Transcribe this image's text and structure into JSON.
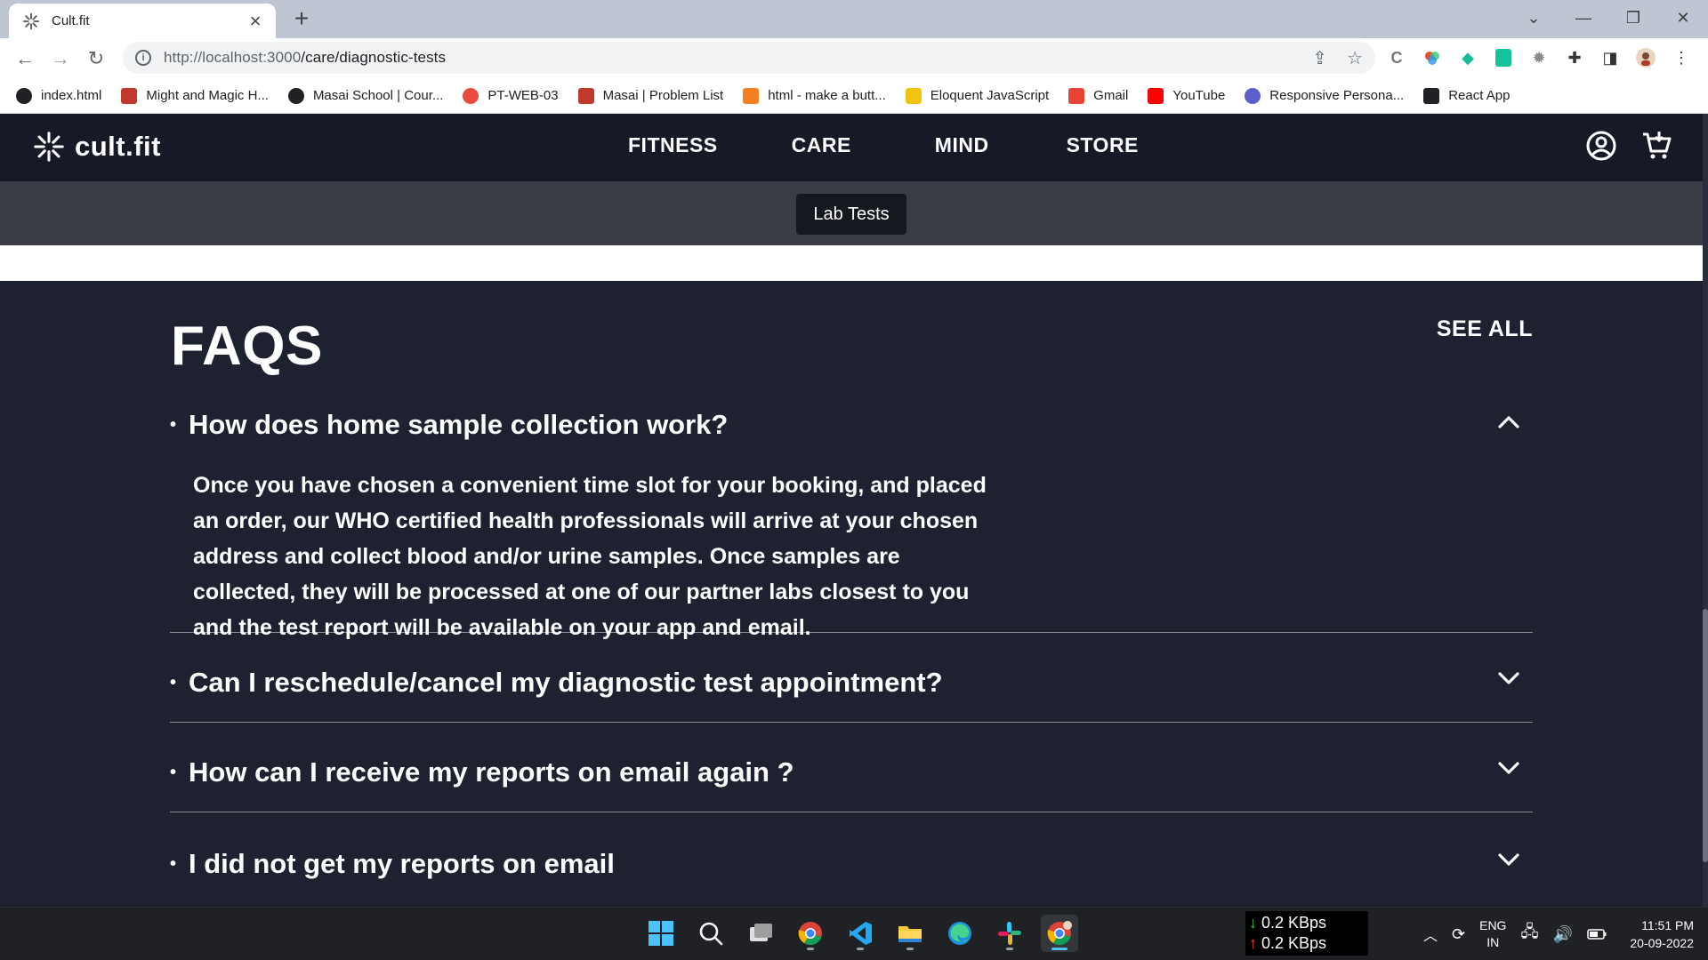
{
  "browser": {
    "tab_title": "Cult.fit",
    "url_host": "http://localhost:3000",
    "url_path": "/care/diagnostic-tests",
    "bookmarks": [
      {
        "label": "index.html",
        "icon": "globe-icon",
        "color": "#202124"
      },
      {
        "label": "Might and Magic H...",
        "icon": "game-icon",
        "color": "#c0392b"
      },
      {
        "label": "Masai School | Cour...",
        "icon": "globe-icon",
        "color": "#202124"
      },
      {
        "label": "PT-WEB-03",
        "icon": "gear-icon",
        "color": "#e74c3c"
      },
      {
        "label": "Masai | Problem List",
        "icon": "pin-icon",
        "color": "#c0392b"
      },
      {
        "label": "html - make a butt...",
        "icon": "stackoverflow-icon",
        "color": "#f48024"
      },
      {
        "label": "Eloquent JavaScript",
        "icon": "ejs-icon",
        "color": "#f1c40f"
      },
      {
        "label": "Gmail",
        "icon": "gmail-icon",
        "color": "#ea4335"
      },
      {
        "label": "YouTube",
        "icon": "youtube-icon",
        "color": "#ff0000"
      },
      {
        "label": "Responsive Persona...",
        "icon": "globe-icon",
        "color": "#5b5fc7"
      },
      {
        "label": "React App",
        "icon": "cultfit-icon",
        "color": "#202124"
      }
    ]
  },
  "site": {
    "logo_text": "cult.fit",
    "nav": [
      "FITNESS",
      "CARE",
      "MIND",
      "STORE"
    ],
    "subnav_button": "Lab Tests"
  },
  "faq": {
    "title": "FAQS",
    "see_all": "SEE ALL",
    "items": [
      {
        "question": "How does home sample collection work?",
        "expanded": true,
        "answer_lines": [
          "Once you have chosen a convenient time slot for your booking, and placed",
          "an order, our WHO certified health professionals will arrive at your chosen",
          "address and collect blood and/or urine samples. Once samples are",
          "collected, they will be processed at one of our partner labs closest to you",
          "and the test report will be available on your app and email."
        ]
      },
      {
        "question": "Can I reschedule/cancel my diagnostic test appointment?",
        "expanded": false
      },
      {
        "question": "How can I receive my reports on email again ?",
        "expanded": false
      },
      {
        "question": "I did not get my reports on email",
        "expanded": false
      }
    ]
  },
  "taskbar": {
    "net_down": "0.2 KBps",
    "net_up": "0.2 KBps",
    "lang_top": "ENG",
    "lang_bottom": "IN",
    "time": "11:51 PM",
    "date": "20-09-2022",
    "apps": [
      "windows-start-icon",
      "search-icon",
      "task-view-icon",
      "chrome-icon",
      "vscode-icon",
      "file-explorer-icon",
      "edge-icon",
      "slack-icon",
      "chrome-profile-icon"
    ]
  },
  "colors": {
    "page_bg": "#1e2230",
    "header_bg": "#171a26",
    "subnav_bg": "#3a3d45",
    "accent": "#ffffff"
  }
}
